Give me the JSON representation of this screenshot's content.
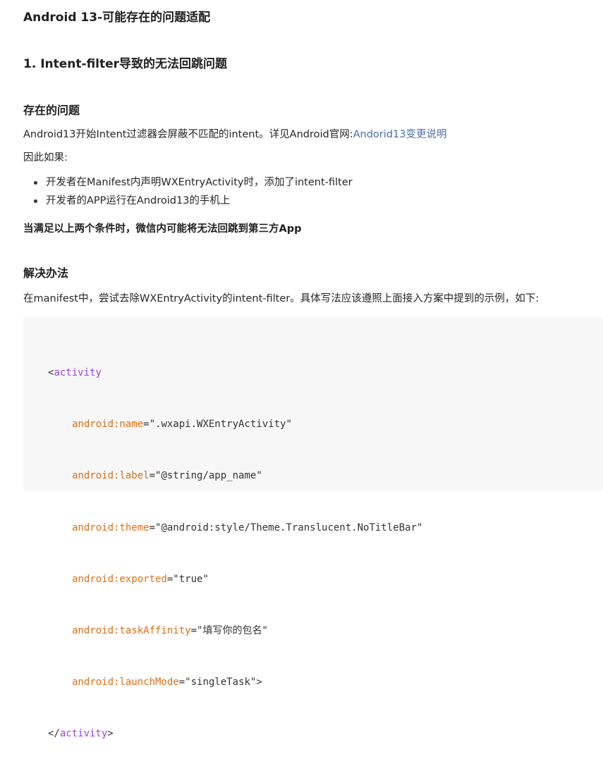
{
  "title": "Android 13-可能存在的问题适配",
  "section1": {
    "heading": "1. Intent-filter导致的无法回跳问题",
    "problem": {
      "heading": "存在的问题",
      "intro_text": "Android13开始Intent过滤器会屏蔽不匹配的intent。详见Android官网:",
      "link_text": "Andorid13变更说明",
      "condition_text": "因此如果:",
      "bullets": [
        "开发者在Manifest内声明WXEntryActivity时，添加了intent-filter",
        "开发者的APP运行在Android13的手机上"
      ],
      "conclusion": "当满足以上两个条件时，微信内可能将无法回跳到第三方App"
    },
    "solution": {
      "heading": "解决办法",
      "text": "在manifest中，尝试去除WXEntryActivity的intent-filter。具体写法应该遵照上面接入方案中提到的示例，如下:"
    }
  },
  "code": {
    "open_lt": "<",
    "tag_name": "activity",
    "gt": ">",
    "close_lt": "</",
    "eq": "=",
    "attrs": [
      {
        "name": "android:name",
        "value": "\".wxapi.WXEntryActivity\""
      },
      {
        "name": "android:label",
        "value": "\"@string/app_name\""
      },
      {
        "name": "android:theme",
        "value": "\"@android:style/Theme.Translucent.NoTitleBar\""
      },
      {
        "name": "android:exported",
        "value": "\"true\""
      },
      {
        "name": "android:taskAffinity",
        "value": "\"填写你的包名\""
      },
      {
        "name": "android:launchMode",
        "value": "\"singleTask\""
      }
    ]
  },
  "colors": {
    "link": "#4e6ea8",
    "code_tag": "#9b45d4",
    "code_attr": "#d6701a",
    "code_background": "#f7f7f8"
  }
}
